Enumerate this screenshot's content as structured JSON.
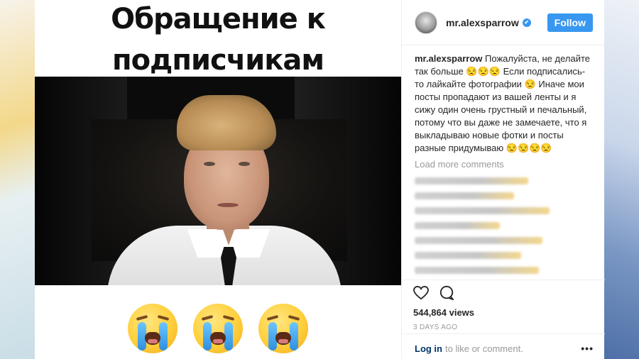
{
  "post": {
    "caption_line1": "Обращение к",
    "caption_line2": "подписчикам"
  },
  "header": {
    "username": "mr.alexsparrow",
    "verified_icon": "✔",
    "follow_label": "Follow"
  },
  "comments": {
    "author": "mr.alexsparrow",
    "text_1": "Пожалуйста, не делайте так больше",
    "emoji_1": "😒😒😒",
    "text_2": "Если подписались- то лайкайте фотографии",
    "emoji_2": "😒",
    "text_3": "Иначе мои посты пропадают из вашей ленты и я сижу один очень грустный и печальный, потому что вы даже не замечаете, что я выкладываю новые фотки и посты разные придумываю",
    "emoji_3": "😒😒😒😒",
    "load_more": "Load more comments"
  },
  "stats": {
    "views": "544,864 views",
    "time": "3 DAYS AGO"
  },
  "footer": {
    "login_link": "Log in",
    "login_text": "to like or comment.",
    "more_icon": "•••"
  },
  "icons": {
    "heart": "heart-icon",
    "comment": "comment-icon",
    "more": "more-icon"
  },
  "colors": {
    "accent": "#3897f0",
    "text": "#262626",
    "muted": "#999999"
  }
}
